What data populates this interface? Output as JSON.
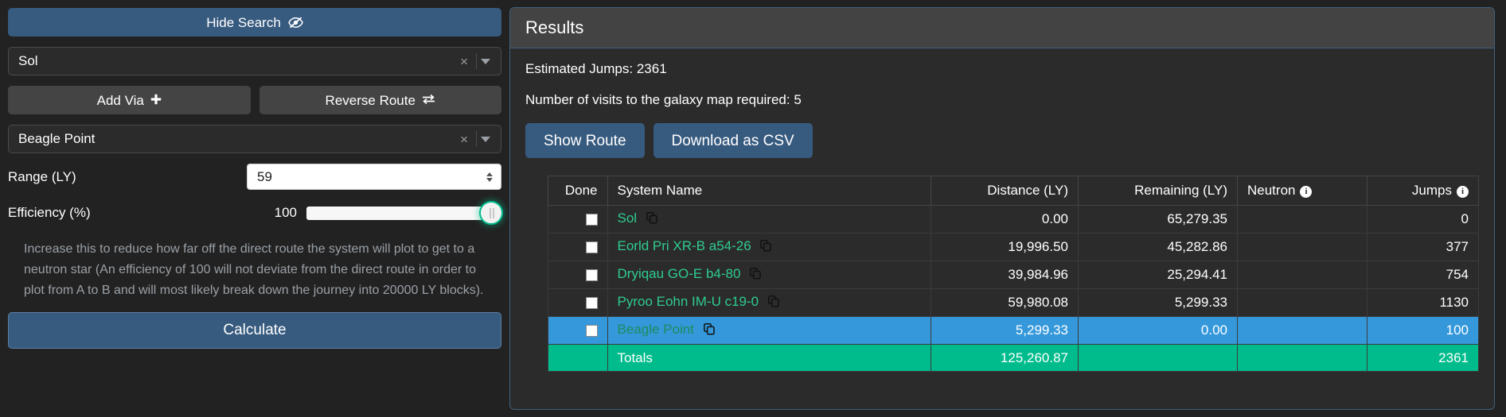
{
  "search_panel": {
    "hide_search_label": "Hide Search",
    "hide_search_icon": "eye-slash-icon",
    "source": {
      "value": "Sol",
      "clear_label": "×",
      "caret_icon": "chevron-down-icon"
    },
    "destination": {
      "value": "Beagle Point",
      "clear_label": "×",
      "caret_icon": "chevron-down-icon"
    },
    "add_via_label": "Add Via",
    "add_via_icon": "plus-icon",
    "reverse_route_label": "Reverse Route",
    "reverse_route_icon": "swap-arrows-icon",
    "range_label": "Range (LY)",
    "range_value": "59",
    "efficiency_label": "Efficiency (%)",
    "efficiency_value": "100",
    "help_text": "Increase this to reduce how far off the direct route the system will plot to get to a neutron star (An efficiency of 100 will not deviate from the direct route in order to plot from A to B and will most likely break down the journey into 20000 LY blocks).",
    "calculate_label": "Calculate"
  },
  "results": {
    "title": "Results",
    "estimated_jumps": "Estimated Jumps: 2361",
    "galaxy_map_visits": "Number of visits to the galaxy map required: 5",
    "show_route_label": "Show Route",
    "download_csv_label": "Download as CSV",
    "table": {
      "columns": [
        {
          "key": "done",
          "label": "Done",
          "align": "right",
          "info": false
        },
        {
          "key": "system",
          "label": "System Name",
          "align": "left",
          "info": false
        },
        {
          "key": "dist",
          "label": "Distance (LY)",
          "align": "right",
          "info": false
        },
        {
          "key": "rem",
          "label": "Remaining (LY)",
          "align": "right",
          "info": false
        },
        {
          "key": "neutron",
          "label": "Neutron",
          "align": "left",
          "info": true
        },
        {
          "key": "jumps",
          "label": "Jumps",
          "align": "right",
          "info": true
        }
      ],
      "rows": [
        {
          "system": "Sol",
          "dist": "0.00",
          "rem": "65,279.35",
          "neutron": "",
          "jumps": "0",
          "highlight": false
        },
        {
          "system": "Eorld Pri XR-B a54-26",
          "dist": "19,996.50",
          "rem": "45,282.86",
          "neutron": "",
          "jumps": "377",
          "highlight": false
        },
        {
          "system": "Dryiqau GO-E b4-80",
          "dist": "39,984.96",
          "rem": "25,294.41",
          "neutron": "",
          "jumps": "754",
          "highlight": false
        },
        {
          "system": "Pyroo Eohn IM-U c19-0",
          "dist": "59,980.08",
          "rem": "5,299.33",
          "neutron": "",
          "jumps": "1130",
          "highlight": false
        },
        {
          "system": "Beagle Point",
          "dist": "5,299.33",
          "rem": "0.00",
          "neutron": "",
          "jumps": "100",
          "highlight": true
        }
      ],
      "totals": {
        "label": "Totals",
        "dist": "125,260.87",
        "rem": "",
        "neutron": "",
        "jumps": "2361"
      },
      "copy_icon": "copy-icon",
      "checkbox_icon": "checkbox-unchecked-icon",
      "info_icon_label": "i"
    }
  },
  "colors": {
    "accent_blue": "#375a7f",
    "highlight_blue": "#3498db",
    "totals_green": "#00bc8c",
    "system_green": "#2ecc8f",
    "background": "#222222",
    "panel": "#2b2b2b"
  }
}
